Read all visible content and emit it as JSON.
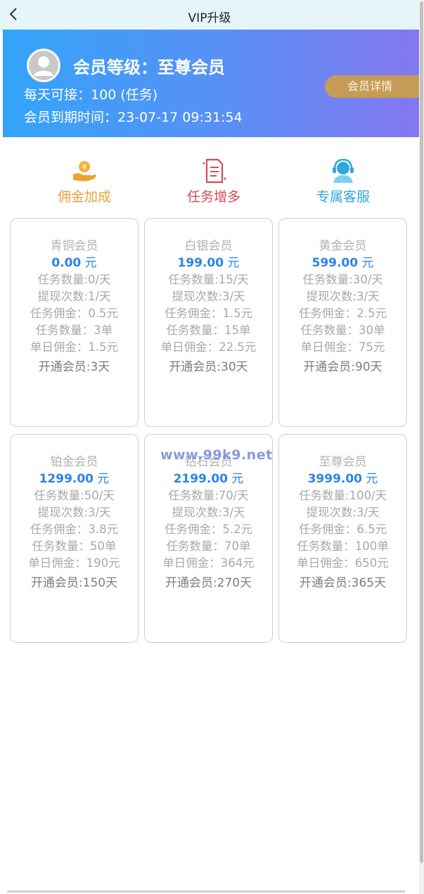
{
  "header": {
    "title": "VIP升级"
  },
  "profile": {
    "level_label": "会员等级：",
    "level_value": "至尊会员",
    "daily_line": "每天可接：100 (任务)",
    "expire_line": "会员到期时间：23-07-17 09:31:54",
    "detail_button": "会员详情"
  },
  "features": [
    {
      "label": "佣金加成",
      "icon": "hand-coin-icon",
      "color": "#e8a33a"
    },
    {
      "label": "任务增多",
      "icon": "document-list-icon",
      "color": "#d94a5a"
    },
    {
      "label": "专属客服",
      "icon": "customer-service-icon",
      "color": "#2fa7e0"
    }
  ],
  "plans": [
    {
      "name": "青铜会员",
      "price": "0.00",
      "unit": "元",
      "task_count": "任务数量:0/天",
      "withdraw": "提现次数:1/天",
      "commission": "任务佣金：0.5元",
      "task_qty": "任务数量：3单",
      "daily_commission": "单日佣金：1.5元",
      "open": "开通会员:3天"
    },
    {
      "name": "白银会员",
      "price": "199.00",
      "unit": "元",
      "task_count": "任务数量:15/天",
      "withdraw": "提现次数:3/天",
      "commission": "任务佣金：1.5元",
      "task_qty": "任务数量：15单",
      "daily_commission": "单日佣金：22.5元",
      "open": "开通会员:30天"
    },
    {
      "name": "黄金会员",
      "price": "599.00",
      "unit": "元",
      "task_count": "任务数量:30/天",
      "withdraw": "提现次数:3/天",
      "commission": "任务佣金：2.5元",
      "task_qty": "任务数量：30单",
      "daily_commission": "单日佣金：75元",
      "open": "开通会员:90天"
    },
    {
      "name": "铂金会员",
      "price": "1299.00",
      "unit": "元",
      "task_count": "任务数量:50/天",
      "withdraw": "提现次数:3/天",
      "commission": "任务佣金：3.8元",
      "task_qty": "任务数量：50单",
      "daily_commission": "单日佣金：190元",
      "open": "开通会员:150天"
    },
    {
      "name": "钻石会员",
      "price": "2199.00",
      "unit": "元",
      "task_count": "任务数量:70/天",
      "withdraw": "提现次数:3/天",
      "commission": "任务佣金：5.2元",
      "task_qty": "任务数量：70单",
      "daily_commission": "单日佣金：364元",
      "open": "开通会员:270天"
    },
    {
      "name": "至尊会员",
      "price": "3999.00",
      "unit": "元",
      "task_count": "任务数量:100/天",
      "withdraw": "提现次数:3/天",
      "commission": "任务佣金：6.5元",
      "task_qty": "任务数量：100单",
      "daily_commission": "单日佣金：650元",
      "open": "开通会员:365天"
    }
  ],
  "watermark": "www.99k9.net",
  "colors": {
    "hero_start": "#33a4f9",
    "hero_end": "#8477f1",
    "price": "#2b84e8",
    "detail_button": "#c59c56"
  }
}
